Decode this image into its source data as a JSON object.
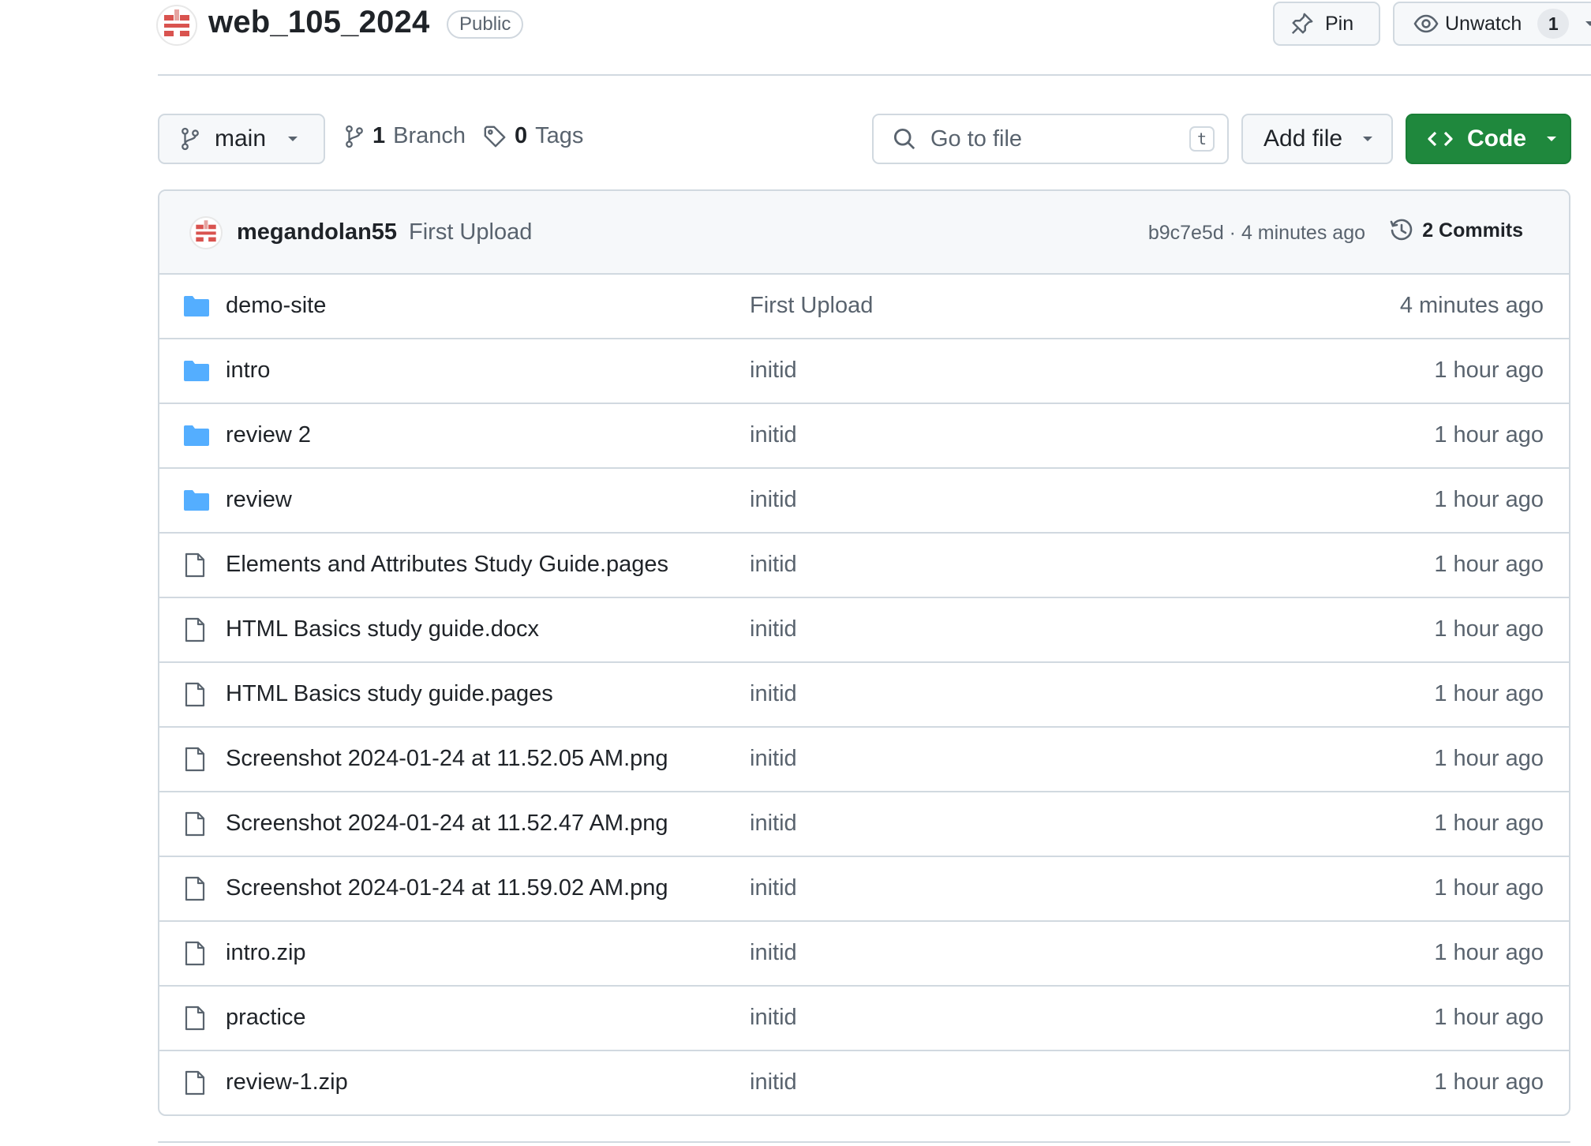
{
  "repo": {
    "name": "web_105_2024",
    "visibility": "Public"
  },
  "actions": {
    "pin_label": "Pin",
    "watch_label": "Unwatch",
    "watch_count": "1"
  },
  "toolbar": {
    "branch": "main",
    "branch_count": "1",
    "branch_label": "Branch",
    "tag_count": "0",
    "tag_label": "Tags",
    "search_placeholder": "Go to file",
    "search_shortcut": "t",
    "add_file_label": "Add file",
    "code_label": "Code"
  },
  "latest_commit": {
    "author": "megandolan55",
    "message": "First Upload",
    "meta": "b9c7e5d · 4 minutes ago",
    "commits_label": "2 Commits"
  },
  "files": [
    {
      "name": "demo-site",
      "type": "folder",
      "message": "First Upload",
      "time": "4 minutes ago"
    },
    {
      "name": "intro",
      "type": "folder",
      "message": "initid",
      "time": "1 hour ago"
    },
    {
      "name": "review 2",
      "type": "folder",
      "message": "initid",
      "time": "1 hour ago"
    },
    {
      "name": "review",
      "type": "folder",
      "message": "initid",
      "time": "1 hour ago"
    },
    {
      "name": "Elements and Attributes Study Guide.pages",
      "type": "file",
      "message": "initid",
      "time": "1 hour ago"
    },
    {
      "name": "HTML Basics study guide.docx",
      "type": "file",
      "message": "initid",
      "time": "1 hour ago"
    },
    {
      "name": "HTML Basics study guide.pages",
      "type": "file",
      "message": "initid",
      "time": "1 hour ago"
    },
    {
      "name": "Screenshot 2024-01-24 at 11.52.05 AM.png",
      "type": "file",
      "message": "initid",
      "time": "1 hour ago"
    },
    {
      "name": "Screenshot 2024-01-24 at 11.52.47 AM.png",
      "type": "file",
      "message": "initid",
      "time": "1 hour ago"
    },
    {
      "name": "Screenshot 2024-01-24 at 11.59.02 AM.png",
      "type": "file",
      "message": "initid",
      "time": "1 hour ago"
    },
    {
      "name": "intro.zip",
      "type": "file",
      "message": "initid",
      "time": "1 hour ago"
    },
    {
      "name": "practice",
      "type": "file",
      "message": "initid",
      "time": "1 hour ago"
    },
    {
      "name": "review-1.zip",
      "type": "file",
      "message": "initid",
      "time": "1 hour ago"
    }
  ],
  "colors": {
    "accent_green": "#1f883d",
    "folder_blue": "#54aeff",
    "muted_text": "#59636e",
    "border": "#d1d9e0"
  }
}
